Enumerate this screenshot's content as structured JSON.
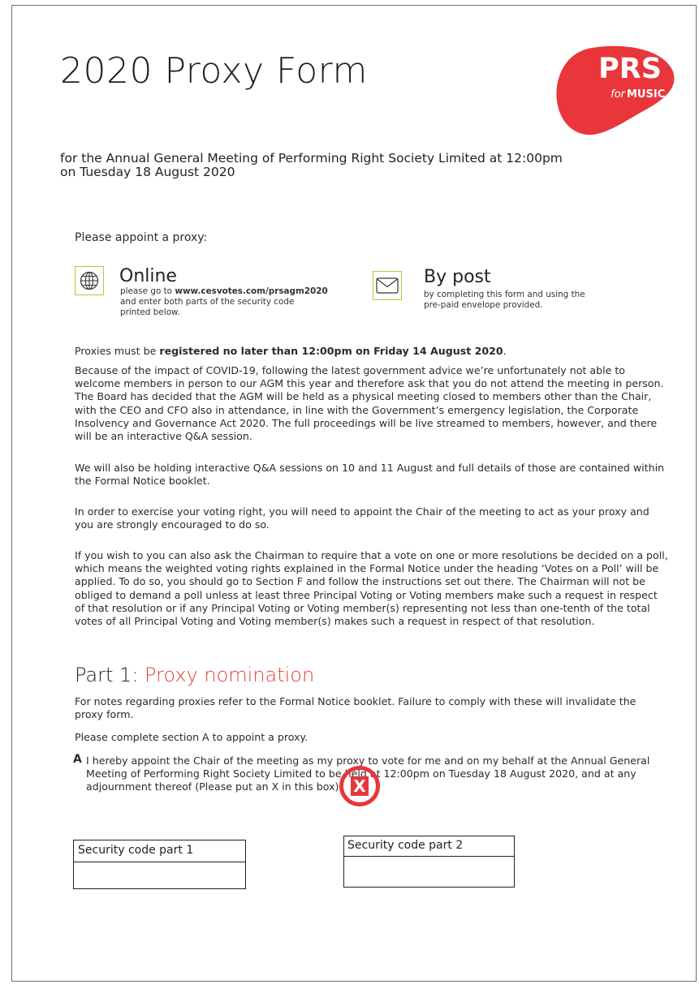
{
  "header": {
    "title": "2020 Proxy Form",
    "subtitle_line1": "for the Annual General Meeting of Performing Right Society Limited at 12:00pm",
    "subtitle_line2": "on Tuesday 18 August 2020"
  },
  "logo": {
    "main": "PRS",
    "for": "for",
    "music": "MUSIC",
    "color": "#e8363b"
  },
  "intro": {
    "label": "Please appoint a proxy:"
  },
  "online": {
    "title": "Online",
    "desc1_pre": "please go to ",
    "url": "www.cesvotes.com/prsagm2020",
    "desc2": "and enter both parts of the security code",
    "desc3": "printed below.",
    "icon": "globe-icon"
  },
  "post": {
    "title": "By post",
    "desc1": "by completing this form and using the",
    "desc2": "pre-paid envelope provided.",
    "icon": "envelope-icon"
  },
  "deadline": {
    "pre": "Proxies must be ",
    "bold": "registered no later than 12:00pm on Friday 14 August 2020",
    "post": "."
  },
  "paragraphs": {
    "covid": [
      "Because of the impact of COVID-19, following the latest government advice we’re unfortunately not able to",
      "welcome members in person to our AGM this year and therefore ask that you do not attend the meeting in person.",
      "The Board has decided that the AGM will be held as a physical meeting closed to members other than the Chair,",
      "with the CEO and CFO also in attendance, in line with the Government’s emergency legislation, the Corporate",
      "Insolvency and Governance Act 2020. The full proceedings will be live streamed to members, however, and there",
      "will be an interactive Q&A session."
    ],
    "qa": [
      "We will also be holding interactive Q&A sessions on 10 and 11 August and full details of those are contained within",
      "the Formal Notice booklet."
    ],
    "voting": [
      "In order to exercise your voting right, you will need to appoint the Chair of the meeting to act as your proxy and",
      "you are strongly encouraged to do so."
    ],
    "poll": [
      "If you wish to you can also ask the Chairman to require that a vote on one or more resolutions be decided on a poll,",
      "which means the weighted voting rights explained in the Formal Notice under the heading ‘Votes on a Poll’ will be",
      "applied. To do so, you should go to Section F and follow the instructions set out there. The Chairman will not be",
      "obliged to demand a poll unless at least three Principal Voting or Voting members make such a request in respect",
      "of that resolution or if any Principal Voting or Voting member(s) representing not less than one-tenth of the total",
      "votes of all Principal Voting and Voting member(s) makes such a request in respect of that resolution."
    ]
  },
  "part1": {
    "label": "Part 1: ",
    "title": "Proxy nomination",
    "notes_line1": "For notes regarding proxies refer to the Formal Notice booklet. Failure to comply with these will invalidate the",
    "notes_line2": "proxy form.",
    "instruction": "Please complete section A to appoint a proxy."
  },
  "sectionA": {
    "letter": "A",
    "line1": "I hereby appoint the Chair of the meeting as my proxy to vote for me and on my behalf at the Annual General",
    "line2": "Meeting of Performing Right Society Limited to be held at 12:00pm on Tuesday 18 August 2020, and at any",
    "line3": "adjournment thereof (Please put an X in this box)",
    "mark": "X",
    "mark_color": "#e8363b"
  },
  "security": {
    "part1_label": "Security code part 1",
    "part2_label": "Security code part 2",
    "part1_value": "",
    "part2_value": ""
  }
}
